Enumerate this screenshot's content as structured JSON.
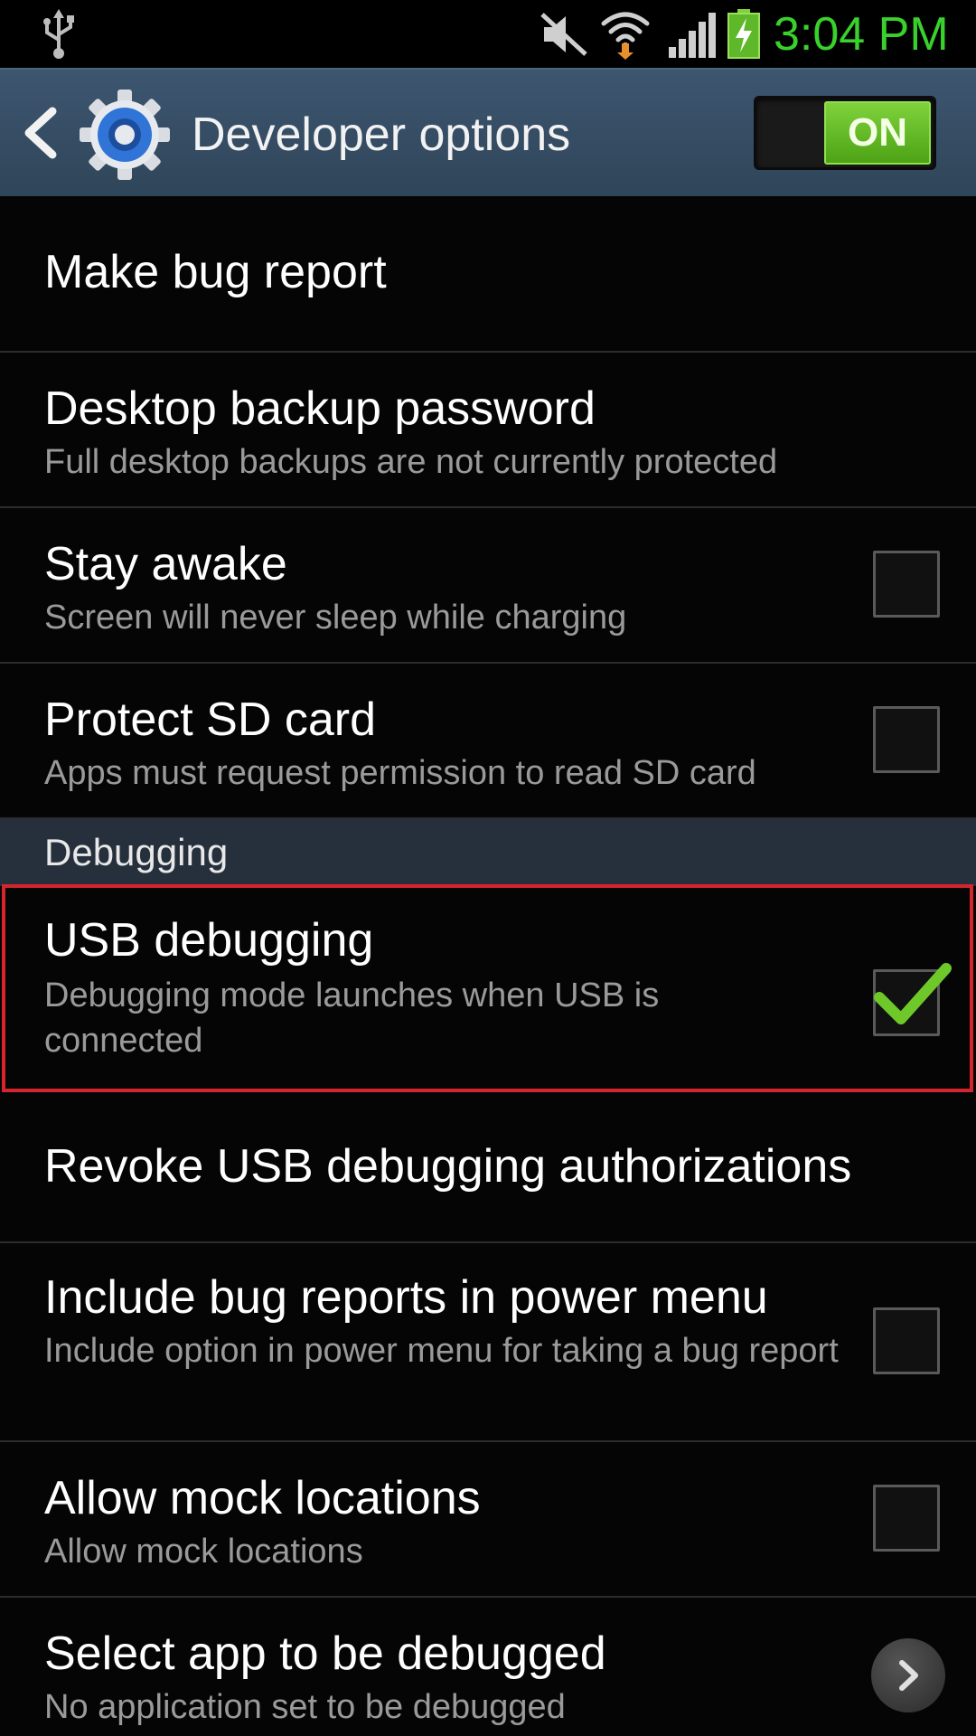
{
  "status_bar": {
    "time": "3:04 PM",
    "icons": [
      "usb-icon",
      "muted-icon",
      "wifi-icon",
      "signal-icon",
      "battery-charging-icon"
    ],
    "clock_color": "#39d12c"
  },
  "action_bar": {
    "title": "Developer options",
    "switch_label": "ON",
    "switch_on": true,
    "accent": "#5fb82a"
  },
  "items": [
    {
      "title": "Make bug report"
    },
    {
      "title": "Desktop backup password",
      "summary": "Full desktop backups are not currently protected"
    },
    {
      "title": "Stay awake",
      "summary": "Screen will never sleep while charging",
      "checked": false
    },
    {
      "title": "Protect SD card",
      "summary": "Apps must request permission to read SD card",
      "checked": false
    },
    {
      "title": "USB debugging",
      "summary": "Debugging mode launches when USB is connected",
      "checked": true
    },
    {
      "title": "Revoke USB debugging authorizations"
    },
    {
      "title": "Include bug reports in power menu",
      "summary": "Include option in power menu for taking a bug report",
      "checked": false
    },
    {
      "title": "Allow mock locations",
      "summary": "Allow mock locations",
      "checked": false
    },
    {
      "title": "Select app to be debugged",
      "summary": "No application set to be debugged"
    }
  ],
  "sections": {
    "debugging": "Debugging"
  }
}
